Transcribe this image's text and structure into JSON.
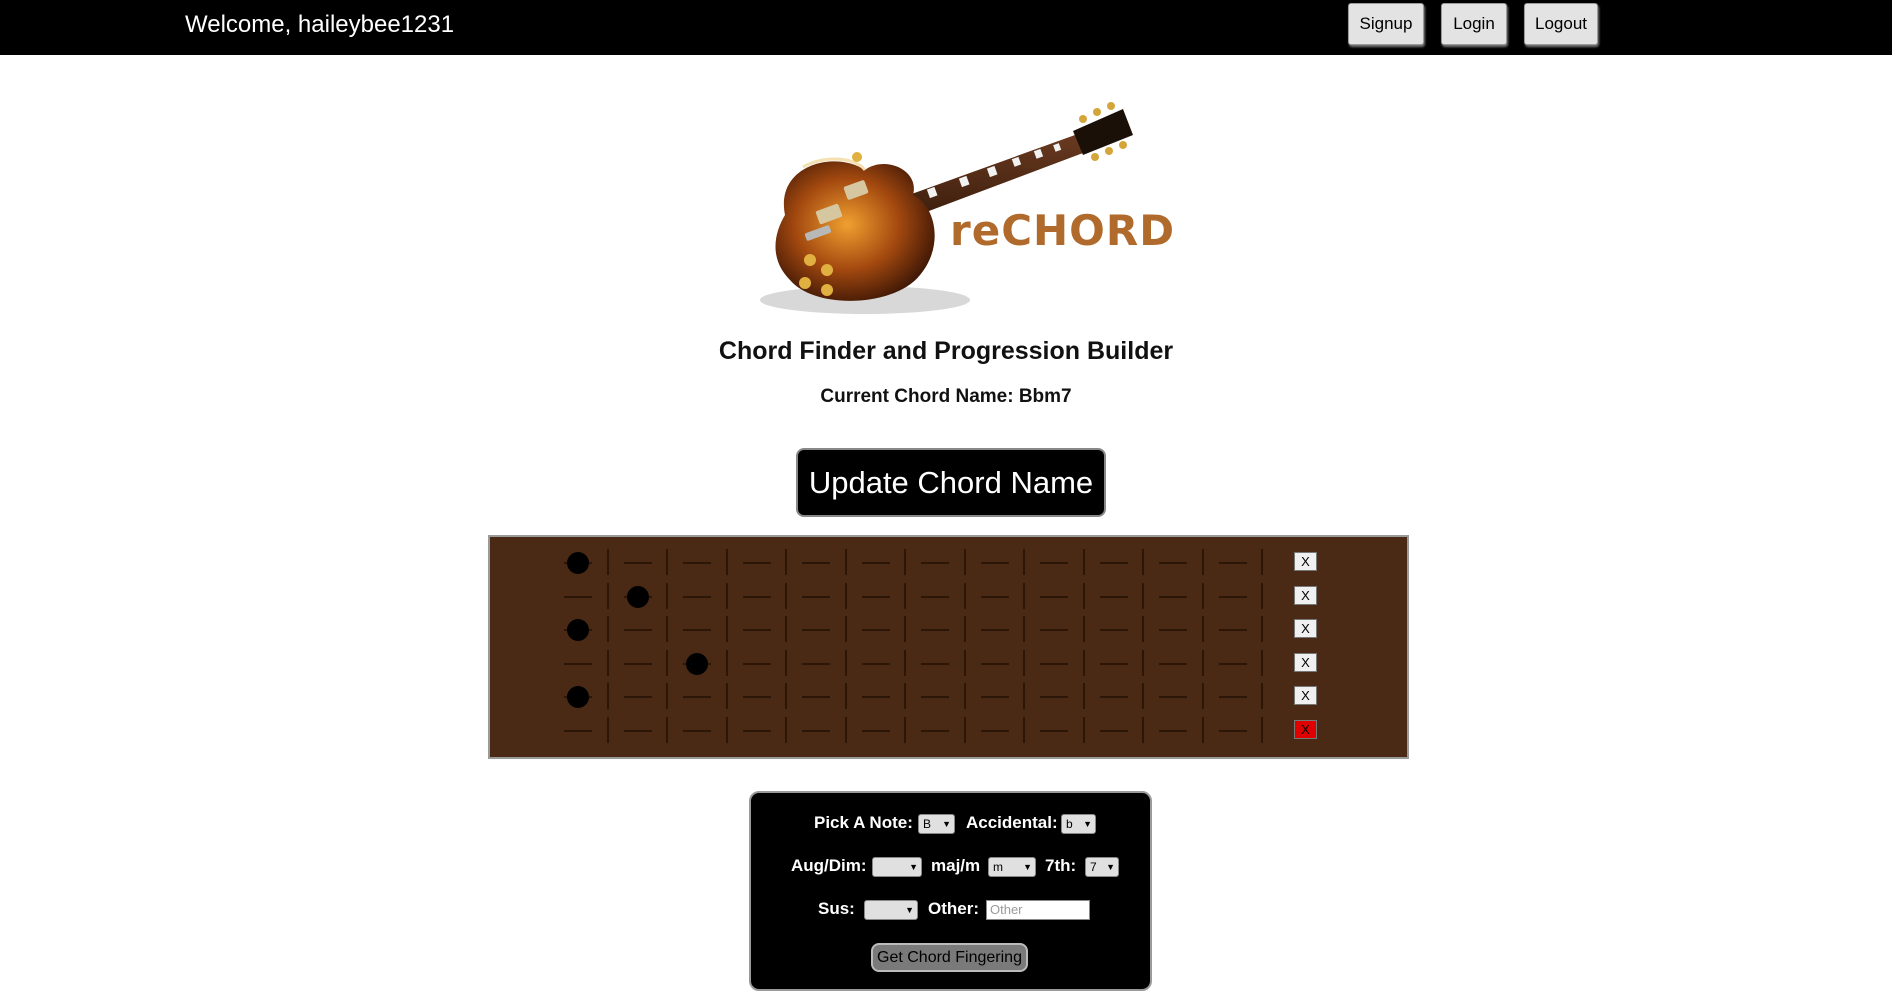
{
  "header": {
    "welcome": "Welcome, haileybee1231",
    "signup_label": "Signup",
    "login_label": "Login",
    "logout_label": "Logout"
  },
  "logo": {
    "text": "reCHORD"
  },
  "main": {
    "title": "Chord Finder and Progression Builder",
    "current_chord": "Current Chord Name: Bbm7",
    "update_label": "Update Chord Name"
  },
  "fretboard": {
    "string_count": 6,
    "fret_count": 12,
    "fingers": [
      {
        "string": 1,
        "fret": 1
      },
      {
        "string": 2,
        "fret": 2
      },
      {
        "string": 3,
        "fret": 1
      },
      {
        "string": 4,
        "fret": 3
      },
      {
        "string": 5,
        "fret": 1
      }
    ],
    "mute_label": "X",
    "muted_strings": [
      6
    ],
    "colors": {
      "board": "#4a2a14",
      "muted": "#e00000"
    }
  },
  "controls": {
    "note_label": "Pick A Note:",
    "note_value": "B",
    "accidental_label": "Accidental:",
    "accidental_value": "b",
    "augdim_label": "Aug/Dim:",
    "augdim_value": "",
    "majm_label": "maj/m",
    "majm_value": "m",
    "seventh_label": "7th:",
    "seventh_value": "7",
    "sus_label": "Sus:",
    "sus_value": "",
    "other_label": "Other:",
    "other_placeholder": "Other",
    "get_label": "Get Chord Fingering"
  }
}
